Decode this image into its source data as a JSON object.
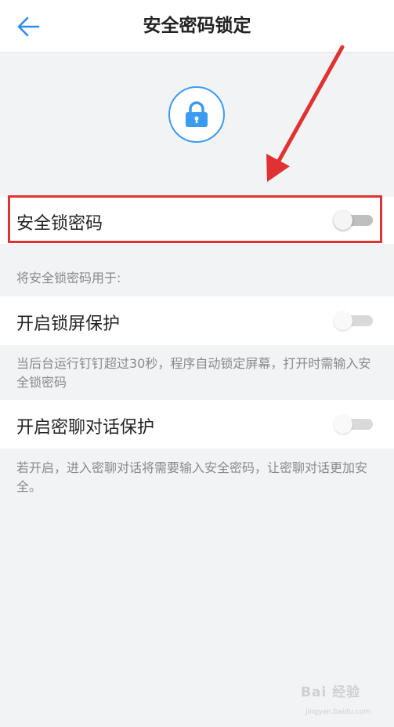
{
  "header": {
    "title": "安全密码锁定",
    "back_icon": "back-arrow-icon"
  },
  "lock": {
    "icon": "lock-icon",
    "accent_color": "#3b9bf0"
  },
  "security_lock": {
    "label": "安全锁密码",
    "enabled": false
  },
  "section_caption": "将安全锁密码用于:",
  "lock_screen": {
    "label": "开启锁屏保护",
    "enabled": false,
    "description": "当后台运行钉钉超过30秒，程序自动锁定屏幕，打开时需输入安全锁密码"
  },
  "secret_chat": {
    "label": "开启密聊对话保护",
    "enabled": false,
    "description": "若开启，进入密聊对话将需要输入安全密码，让密聊对话更加安全。"
  },
  "annotation": {
    "highlight_color": "#e03232"
  },
  "watermark": {
    "text": "Bai 经验",
    "sub": "jingyan.baidu.com"
  }
}
